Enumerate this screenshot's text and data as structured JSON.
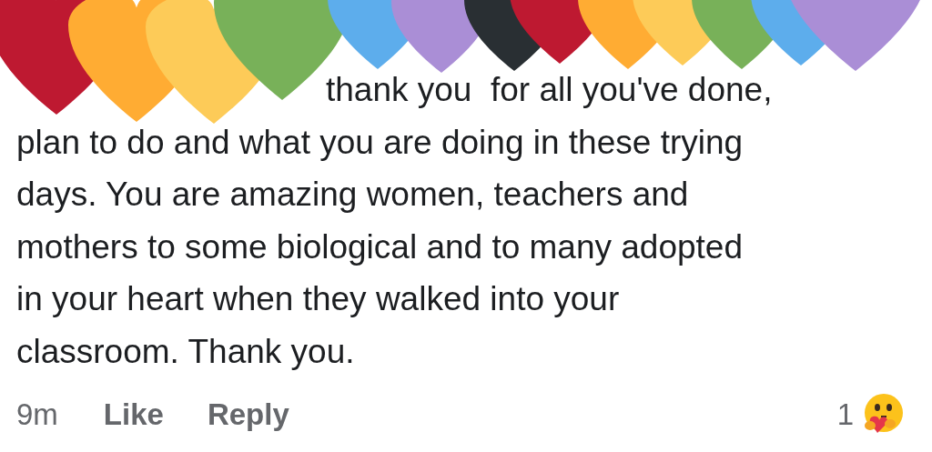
{
  "hearts": [
    {
      "color": "#be1931"
    },
    {
      "color": "#ffac33"
    },
    {
      "color": "#fdcb58"
    },
    {
      "color": "#78b159"
    },
    {
      "color": "#5dadec"
    },
    {
      "color": "#aa8ed6"
    },
    {
      "color": "#292f33"
    },
    {
      "color": "#be1931"
    },
    {
      "color": "#ffac33"
    },
    {
      "color": "#fdcb58"
    },
    {
      "color": "#78b159"
    },
    {
      "color": "#5dadec"
    },
    {
      "color": "#aa8ed6"
    }
  ],
  "comment": {
    "text": "thank you  for all you've done,\nplan to do and what you are doing in these trying\ndays. You are amazing women, teachers and\nmothers to some biological and to many adopted\nin your heart when they walked into your\nclassroom. Thank you.",
    "time": "9m",
    "like": "Like",
    "reply": "Reply",
    "reaction_count": "1"
  }
}
